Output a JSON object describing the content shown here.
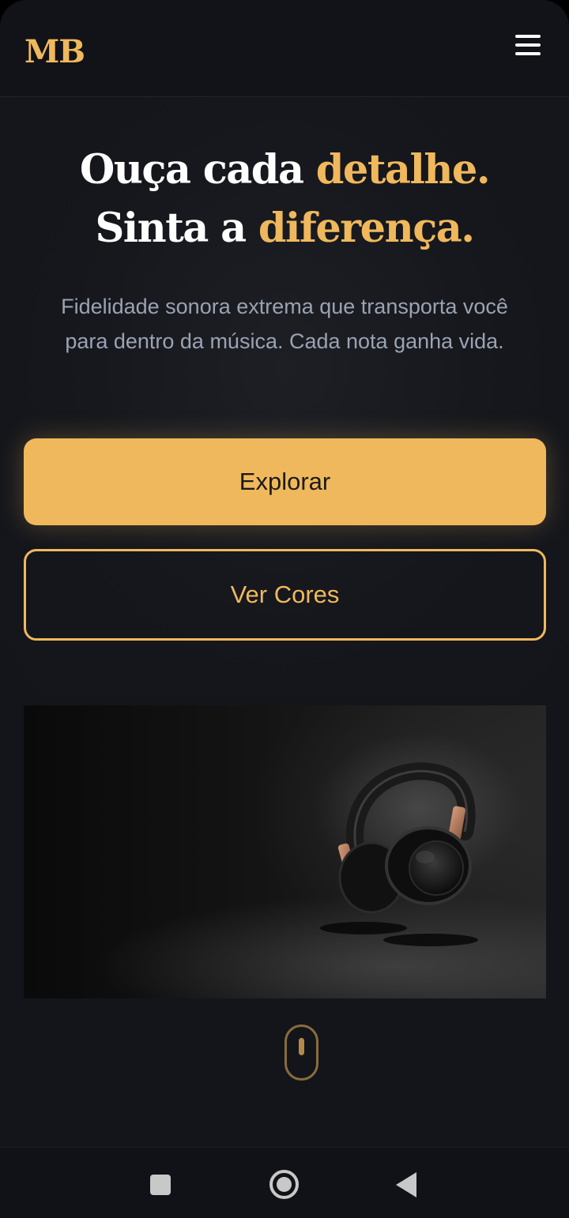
{
  "header": {
    "logo": "MB",
    "menu_icon": "hamburger-menu-icon"
  },
  "hero": {
    "line1_text": "Ouça cada ",
    "line1_accent": "detalhe.",
    "line2_text": "Sinta a ",
    "line2_accent": "diferença.",
    "subtitle": "Fidelidade sonora extrema que transporta você para dentro da música. Cada nota ganha vida."
  },
  "buttons": {
    "primary_label": "Explorar",
    "secondary_label": "Ver Cores"
  },
  "product_image": {
    "subject": "headphones-image"
  },
  "scroll_indicator": {
    "icon": "mouse-scroll-icon"
  },
  "system_nav": {
    "recents_icon": "square-recents-icon",
    "home_icon": "circle-home-icon",
    "back_icon": "triangle-back-icon"
  },
  "colors": {
    "accent": "#f0b85c",
    "background": "#13151b",
    "text": "#ffffff",
    "muted_text": "#9aa3b2"
  }
}
